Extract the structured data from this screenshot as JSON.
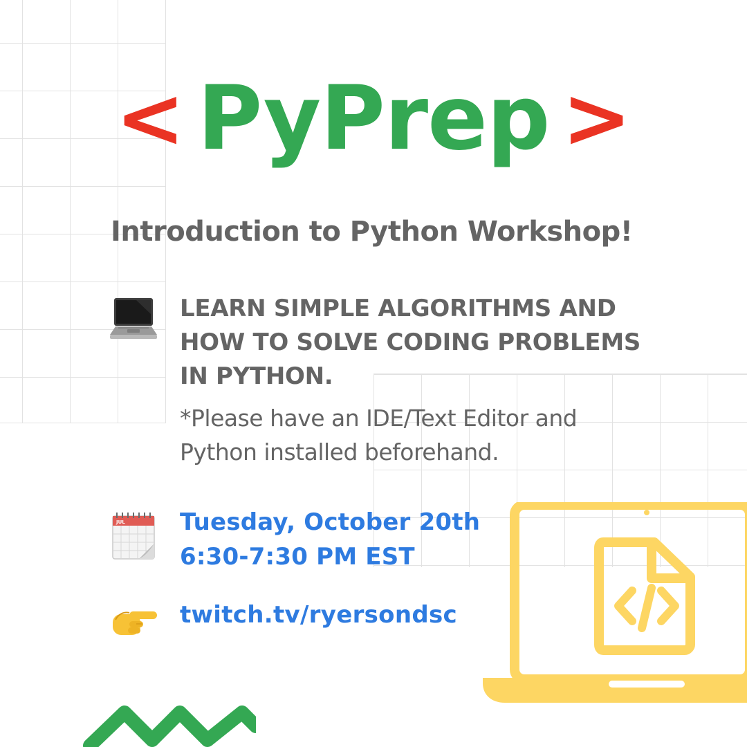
{
  "title": {
    "left_bracket": "<",
    "text": "PyPrep",
    "right_bracket": ">"
  },
  "subtitle": "Introduction to Python Workshop!",
  "details": {
    "learn_line1": "LEARN SIMPLE ALGORITHMS AND",
    "learn_line2": "HOW TO SOLVE CODING PROBLEMS",
    "learn_line3": "IN PYTHON.",
    "note_line1": "*Please have an IDE/Text Editor and",
    "note_line2": "Python installed beforehand.",
    "date_line1": "Tuesday, October 20th",
    "date_line2": "6:30-7:30 PM EST",
    "calendar_month": "JUL",
    "link": "twitch.tv/ryersondsc"
  },
  "icons": {
    "laptop": "laptop-emoji",
    "calendar": "calendar-emoji",
    "pointer": "pointing-hand-emoji",
    "code_laptop": "code-laptop-illustration",
    "zigzag": "zigzag-decoration"
  },
  "colors": {
    "bracket": "#ea3323",
    "title": "#34a853",
    "subtitle_text": "#646464",
    "accent_blue": "#2e7be0",
    "illustration_yellow": "#fdd663",
    "zigzag_green": "#34a853"
  }
}
